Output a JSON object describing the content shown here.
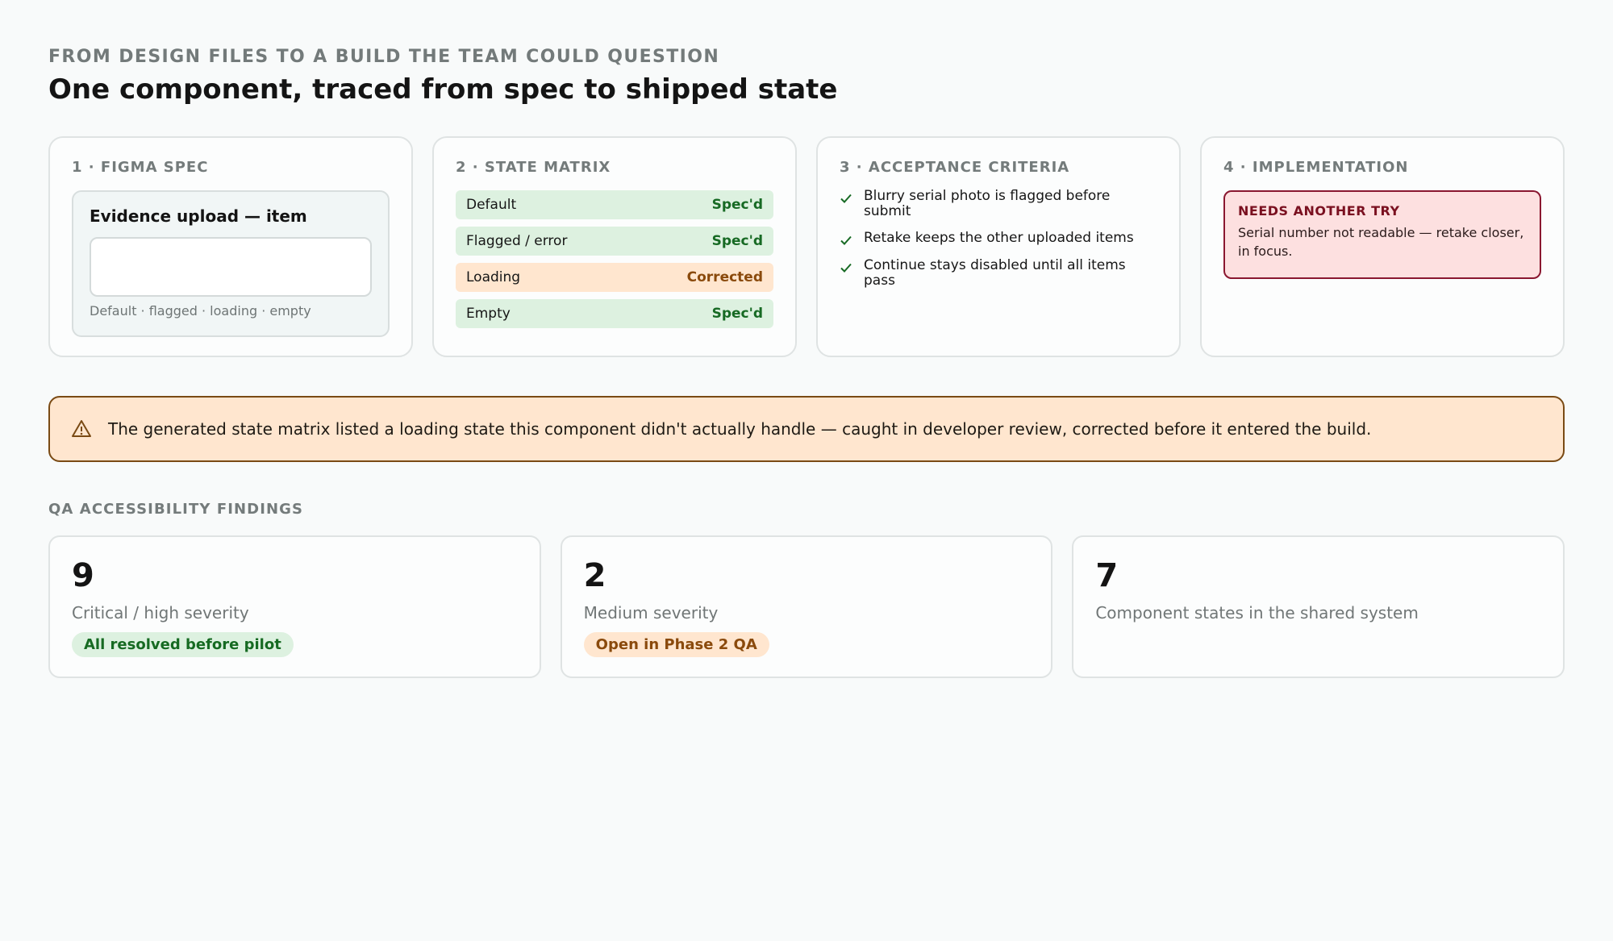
{
  "header": {
    "eyebrow": "FROM DESIGN FILES TO A BUILD THE TEAM COULD QUESTION",
    "title": "One component, traced from spec to shipped state"
  },
  "cards": {
    "figma": {
      "title": "1 · FIGMA SPEC",
      "heading": "Evidence upload — item",
      "caption": "Default · flagged · loading · empty"
    },
    "matrix": {
      "title": "2 · STATE MATRIX",
      "rows": [
        {
          "label": "Default",
          "status": "Spec'd",
          "kind": "ok"
        },
        {
          "label": "Flagged / error",
          "status": "Spec'd",
          "kind": "ok"
        },
        {
          "label": "Loading",
          "status": "Corrected",
          "kind": "fix"
        },
        {
          "label": "Empty",
          "status": "Spec'd",
          "kind": "ok"
        }
      ]
    },
    "criteria": {
      "title": "3 · ACCEPTANCE CRITERIA",
      "items": [
        "Blurry serial photo is flagged before submit",
        "Retake keeps the other uploaded items",
        "Continue stays disabled until all items pass"
      ]
    },
    "implementation": {
      "title": "4 · IMPLEMENTATION",
      "alert_title": "NEEDS ANOTHER TRY",
      "alert_text": "Serial number not readable — retake closer, in focus."
    }
  },
  "banner": {
    "icon": "warning-icon",
    "text": "The generated state matrix listed a loading state this component didn't actually handle — caught in developer review, corrected before it entered the build."
  },
  "qa": {
    "label": "QA ACCESSIBILITY FINDINGS",
    "metrics": [
      {
        "value": "9",
        "label": "Critical / high severity",
        "pill": "All resolved before pilot",
        "pill_kind": "green"
      },
      {
        "value": "2",
        "label": "Medium severity",
        "pill": "Open in Phase 2 QA",
        "pill_kind": "orange"
      },
      {
        "value": "7",
        "label": "Component states in the shared system",
        "pill": "",
        "pill_kind": ""
      }
    ]
  },
  "colors": {
    "success": "#176a24",
    "warning": "#8a4a0c",
    "danger": "#7a1020",
    "background": "#f8fafa"
  }
}
